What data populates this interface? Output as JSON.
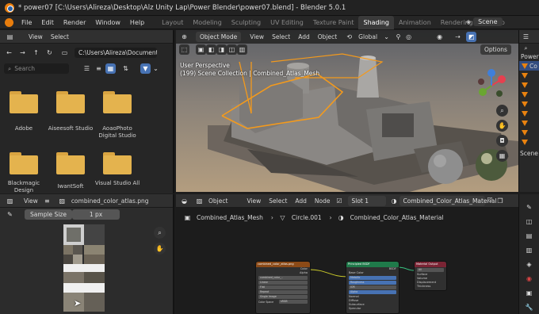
{
  "window": {
    "title": "* power07 [C:\\Users\\Alireza\\Desktop\\Alz Unity Lap\\Power Blender\\power07.blend] - Blender 5.0.1"
  },
  "menu": {
    "items": [
      "File",
      "Edit",
      "Render",
      "Window",
      "Help"
    ],
    "workspaces": [
      "Layout",
      "Modeling",
      "Sculpting",
      "UV Editing",
      "Texture Paint",
      "Shading",
      "Animation",
      "Rendering",
      "Compo"
    ],
    "active_workspace": "Shading",
    "scene_label": "Scene"
  },
  "file_browser": {
    "view_label": "View",
    "select_label": "Select",
    "path": "C:\\Users\\Alireza\\Documents\\",
    "search_placeholder": "Search",
    "folders": [
      {
        "name": "Adobe"
      },
      {
        "name": "Aiseesoft Studio"
      },
      {
        "name": "AoaoPhoto Digital Studio"
      },
      {
        "name": "Blackmagic Design"
      },
      {
        "name": "IwantSoft"
      },
      {
        "name": "Visual Studio All"
      }
    ]
  },
  "viewport": {
    "mode": "Object Mode",
    "menus": [
      "View",
      "Select",
      "Add",
      "Object"
    ],
    "transform_orientation": "Global",
    "options_label": "Options",
    "hud_line1": "User Perspective",
    "hud_line2": "(199) Scene Collection | Combined_Atlas_Mesh",
    "gizmo_axes": {
      "x_color": "#e6404f",
      "y_color": "#6aa631",
      "z_color": "#3f7fd9"
    }
  },
  "outliner": {
    "label_power": "Power",
    "label_co": "Co",
    "label_scene_coll": "Scene Coll"
  },
  "image_editor": {
    "view_label": "View",
    "image_name": "combined_color_atlas.png",
    "sample_size_label": "Sample Size",
    "sample_size_value": "1 px"
  },
  "shader_editor": {
    "object_label": "Object",
    "menus": [
      "View",
      "Select",
      "Add",
      "Node"
    ],
    "slot_label": "Slot 1",
    "material_name": "Combined_Color_Atlas_Material",
    "breadcrumb": [
      "Combined_Atlas_Mesh",
      "Circle.001",
      "Combined_Color_Atlas_Material"
    ],
    "nodes": {
      "image_texture": {
        "title": "combined_color_atlas.png",
        "outputs": [
          "Color",
          "Alpha"
        ],
        "rows": [
          "combined_color_..",
          "Linear",
          "Flat",
          "Repeat",
          "Single Image",
          "sRGB"
        ],
        "row_labels": [
          "",
          "",
          "",
          "",
          "",
          "Color Space"
        ]
      },
      "principled": {
        "title": "Principled BSDF",
        "output": "BSDF",
        "rows": [
          "Base Color",
          "Metallic",
          "Roughness",
          "IOR",
          "Alpha",
          "Normal",
          "Diffuse",
          "Subsurface",
          "Specular"
        ]
      },
      "material_output": {
        "title": "Material Output",
        "target": "All",
        "rows": [
          "Surface",
          "Volume",
          "Displacement",
          "Thickness"
        ]
      }
    }
  }
}
